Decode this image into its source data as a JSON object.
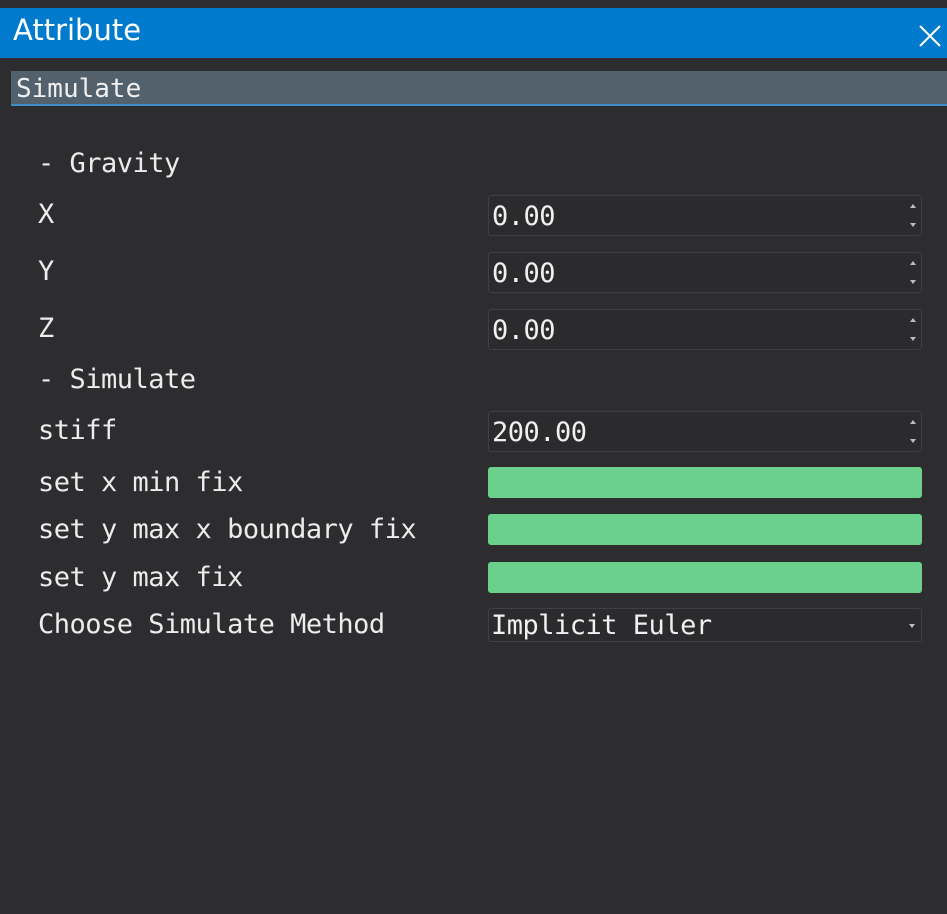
{
  "window": {
    "title": "Attribute",
    "close_icon": "close-icon"
  },
  "panel": {
    "header": "Simulate"
  },
  "gravity": {
    "section_label": "- Gravity",
    "x": {
      "label": "X",
      "value": "0.00"
    },
    "y": {
      "label": "Y",
      "value": "0.00"
    },
    "z": {
      "label": "Z",
      "value": "0.00"
    }
  },
  "simulate": {
    "section_label": "- Simulate",
    "stiff": {
      "label": "stiff",
      "value": "200.00"
    },
    "set_x_min_fix": {
      "label": "set x min fix"
    },
    "set_y_max_x_boundary_fix": {
      "label": "set y max x boundary fix"
    },
    "set_y_max_fix": {
      "label": "set y max fix"
    },
    "method": {
      "label": "Choose Simulate Method",
      "value": "Implicit Euler"
    }
  },
  "colors": {
    "titlebar": "#007acc",
    "background": "#2d2d30",
    "header_bar": "#52616c",
    "toggle_on": "#6ad08b"
  }
}
